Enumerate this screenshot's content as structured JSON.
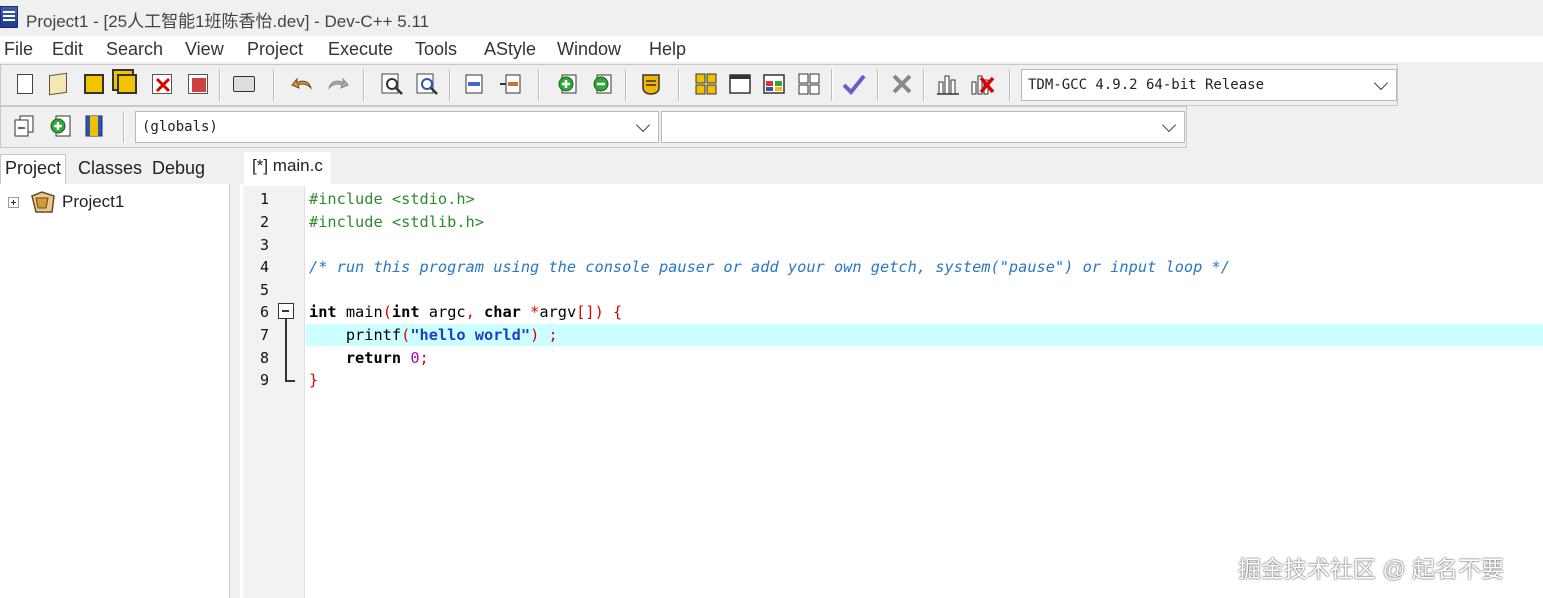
{
  "window": {
    "title": "Project1 - [25人工智能1班陈香怡.dev] - Dev-C++ 5.11"
  },
  "menu": [
    "File",
    "Edit",
    "Search",
    "View",
    "Project",
    "Execute",
    "Tools",
    "AStyle",
    "Window",
    "Help"
  ],
  "toolbar": {
    "compiler": "TDM-GCC 4.9.2 64-bit Release"
  },
  "toolbar2": {
    "scope": "(globals)",
    "function": ""
  },
  "left_tabs": [
    "Project",
    "Classes",
    "Debug"
  ],
  "tree": {
    "root": "Project1"
  },
  "editor": {
    "tab": "[*] main.c",
    "line_numbers": [
      "1",
      "2",
      "3",
      "4",
      "5",
      "6",
      "7",
      "8",
      "9"
    ],
    "lines": [
      [
        "#include <stdio.h>"
      ],
      [
        "#include <stdlib.h>"
      ],
      [
        ""
      ],
      [
        "/* run this program using the console pauser or add your own getch, system(\"pause\") or input loop */"
      ],
      [
        ""
      ],
      [
        "int",
        " main",
        "(",
        "int",
        " argc",
        ",",
        " char",
        " *",
        "argv",
        "[])",
        " {"
      ],
      [
        "    printf",
        "(",
        "\"hello world\"",
        ")",
        " ;"
      ],
      [
        "    return",
        " ",
        "0",
        ";"
      ],
      [
        "}"
      ]
    ]
  },
  "watermark": "掘金技术社区 @ 起名不要"
}
